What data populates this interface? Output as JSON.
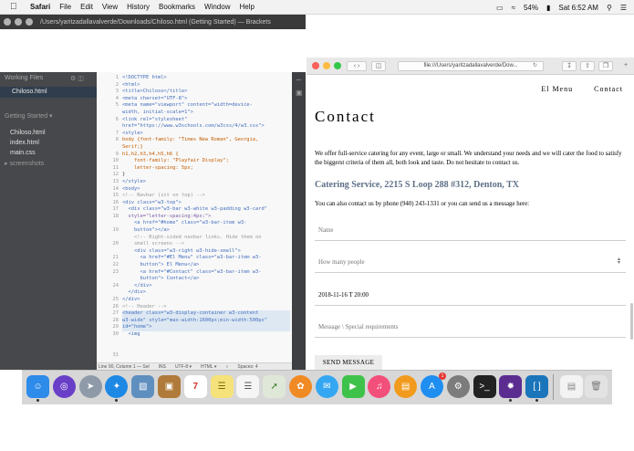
{
  "menubar": {
    "app": "Safari",
    "menus": [
      "File",
      "Edit",
      "View",
      "History",
      "Bookmarks",
      "Window",
      "Help"
    ],
    "battery": "54%",
    "clock": "Sat 6:52 AM"
  },
  "brackets": {
    "title": "/Users/yaritzadallavalverde/Downloads/Chiloso.html (Getting Started) — Brackets",
    "working_files_header": "Working Files",
    "working_file": "Chiloso.html",
    "project_header": "Getting Started",
    "project_files": [
      "Chiloso.html",
      "index.html",
      "main.css"
    ],
    "project_folder": "screenshots",
    "line_numbers": [
      "1",
      "2",
      "3",
      "4",
      "5",
      "6",
      "7",
      "8",
      "9",
      "10",
      "11",
      "12",
      "13",
      "14",
      "15",
      "16",
      "17",
      "18",
      "19",
      "20",
      "21",
      "22",
      "23",
      "24",
      "25",
      "26",
      "27",
      "28",
      "29",
      "30",
      "31"
    ],
    "status": {
      "position": "Line 90, Column 1 — Sel",
      "mode": "INS",
      "encoding": "UTF-8 ▾",
      "language": "HTML ▾",
      "spaces": "Spaces: 4"
    }
  },
  "code": {
    "l01": "<!DOCTYPE html>",
    "l02": "<html>",
    "l03": "<title>Chiloso</title>",
    "l04": "<meta charset=\"UTF-8\">",
    "l05a": "<meta name=\"viewport\" content=\"width=device-",
    "l05b": "width, initial-scale=1\">",
    "l06a": "<link rel=\"stylesheet\"",
    "l06b": "href=\"https://www.w3schools.com/w3css/4/w3.css\">",
    "l07": "<style>",
    "l08a": "body {font-family: \"Times New Roman\", Georgia,",
    "l08b": "Serif;}",
    "l09": "h1,h2,h3,h4,h5,h6 {",
    "l10": "    font-family: \"Playfair Display\";",
    "l11": "    letter-spacing: 5px;",
    "l12": "}",
    "l13": "</style>",
    "l14": "<body>",
    "l15": "",
    "l16": "<!-- Navbar (sit on top) -->",
    "l17": "<div class=\"w3-top\">",
    "l18a": "  <div class=\"w3-bar w3-white w3-padding w3-card\"",
    "l18b": "  style=\"letter-spacing:4px;\">",
    "l19a": "    <a href=\"#home\" class=\"w3-bar-item w3-",
    "l19b": "    button\"></a>",
    "l20a": "    <!-- Right-sided navbar links. Hide them on",
    "l20b": "    small screens -->",
    "l21": "    <div class=\"w3-right w3-hide-small\">",
    "l22": "",
    "l23a": "      <a href=\"#El Menu\" class=\"w3-bar-item w3-",
    "l23b": "      button\"> El Menu</a>",
    "l24a": "      <a href=\"#Contact\" class=\"w3-bar-item w3-",
    "l24b": "      button\"> Contact</a>",
    "l25": "    </div>",
    "l26": "  </div>",
    "l27": "</div>",
    "l28": "",
    "l29": "<!-- Header -->",
    "l30a": "<header class=\"w3-display-container w3-content",
    "l30b": "w3-wide\" style=\"max-width:1600px;min-width:500px\"",
    "l30c": "id=\"home\">",
    "l31": "  <img"
  },
  "safari": {
    "url": "file:///Users/yaritzadallavalverde/Dow..."
  },
  "page": {
    "nav": [
      "El Menu",
      "Contact"
    ],
    "heading": "Contact",
    "intro": "We offer full-service catering for any event, large or small. We understand your needs and we will cater the food to satisfy the biggerst criteria of them all, both look and taste. Do not hesitate to contact us.",
    "address": "Catering Service, 2215 S Loop 288 #312, Denton, TX",
    "phone_line": "You can also contact us by phone (940) 243-1331 or you can send us a message here:",
    "name_placeholder": "Name",
    "people_placeholder": "How many people",
    "datetime_value": "2018-11-16 T 20:00",
    "message_placeholder": "Message \\ Special requirements",
    "send_label": "SEND MESSAGE"
  },
  "dock": {
    "calendar_day": "7",
    "appstore_badge": "1"
  },
  "colors": {
    "brackets_sidebar": "#47484b",
    "address_color": "#5d6f86"
  }
}
